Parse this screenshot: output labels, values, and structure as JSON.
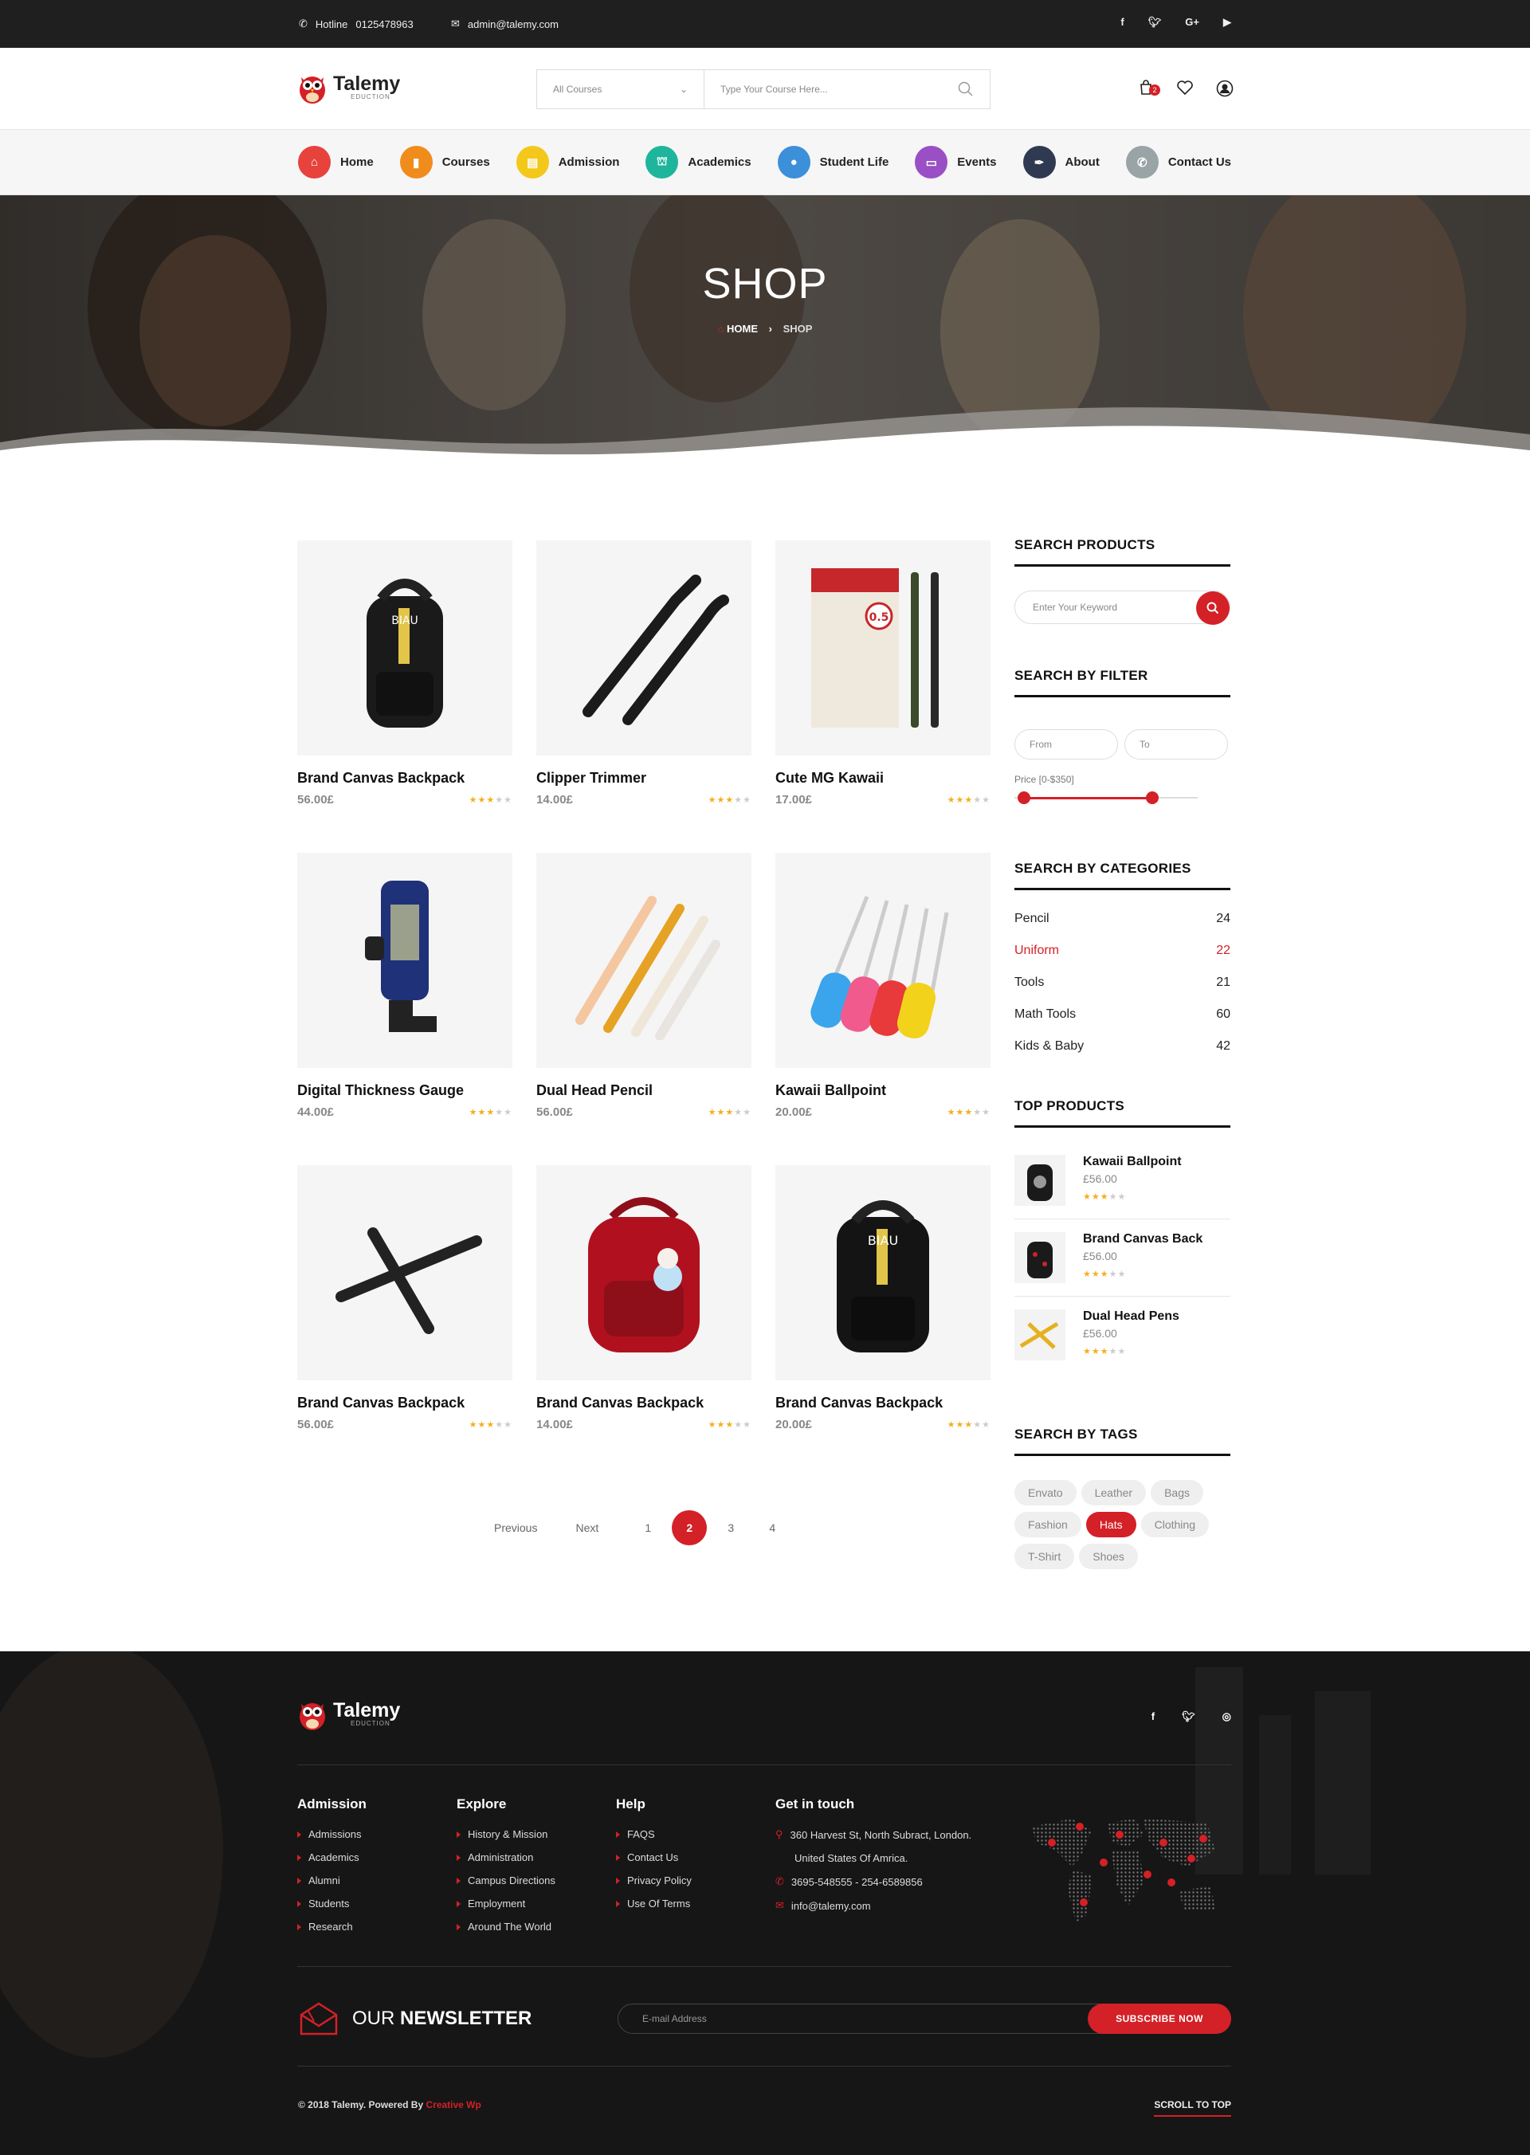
{
  "topbar": {
    "hotline_label": "Hotline",
    "hotline_number": "0125478963",
    "email": "admin@talemy.com",
    "social": [
      "f",
      "t",
      "G+",
      "yt"
    ]
  },
  "brand": {
    "name": "Talemy",
    "tagline": "EDUCTION"
  },
  "header": {
    "category_select": "All Courses",
    "search_placeholder": "Type Your Course Here...",
    "cart_count": "2"
  },
  "nav": {
    "items": [
      {
        "label": "Home",
        "color": "#e8423c"
      },
      {
        "label": "Courses",
        "color": "#f08c1b"
      },
      {
        "label": "Admission",
        "color": "#f3c81a"
      },
      {
        "label": "Academics",
        "color": "#1eb59c"
      },
      {
        "label": "Student Life",
        "color": "#3c8fd9"
      },
      {
        "label": "Events",
        "color": "#9a4fc5"
      },
      {
        "label": "About",
        "color": "#2f3a52"
      },
      {
        "label": "Contact Us",
        "color": "#9aa3a6"
      }
    ]
  },
  "hero": {
    "title": "SHOP",
    "crumb_home": "HOME",
    "crumb_current": "SHOP"
  },
  "products": [
    {
      "name": "Brand Canvas Backpack",
      "price": "56.00£",
      "rating": 3,
      "icon": "black-backpack"
    },
    {
      "name": "Clipper Trimmer",
      "price": "14.00£",
      "rating": 3,
      "icon": "tweezers"
    },
    {
      "name": "Cute MG Kawaii",
      "price": "17.00£",
      "rating": 3,
      "icon": "pen-box"
    },
    {
      "name": "Digital Thickness Gauge",
      "price": "44.00£",
      "rating": 3,
      "icon": "gauge"
    },
    {
      "name": "Dual Head Pencil",
      "price": "56.00£",
      "rating": 3,
      "icon": "pencils"
    },
    {
      "name": "Kawaii Ballpoint",
      "price": "20.00£",
      "rating": 3,
      "icon": "screwdrivers"
    },
    {
      "name": "Brand Canvas Backpack",
      "price": "56.00£",
      "rating": 3,
      "icon": "pencil-holders"
    },
    {
      "name": "Brand Canvas Backpack",
      "price": "14.00£",
      "rating": 3,
      "icon": "red-backpack"
    },
    {
      "name": "Brand Canvas Backpack",
      "price": "20.00£",
      "rating": 3,
      "icon": "black-backpack"
    }
  ],
  "pagination": {
    "previous": "Previous",
    "next": "Next",
    "pages": [
      "1",
      "2",
      "3",
      "4"
    ],
    "current": "2"
  },
  "sidebar": {
    "search_title": "SEARCH PRODUCTS",
    "search_placeholder": "Enter Your Keyword",
    "filter_title": "SEARCH BY FILTER",
    "from_placeholder": "From",
    "to_placeholder": "To",
    "price_label": "Price [0-$350]",
    "price_range_fraction": [
      0.05,
      0.75
    ],
    "categories_title": "SEARCH BY CATEGORIES",
    "categories": [
      {
        "name": "Pencil",
        "count": "24"
      },
      {
        "name": "Uniform",
        "count": "22"
      },
      {
        "name": "Tools",
        "count": "21"
      },
      {
        "name": "Math Tools",
        "count": "60"
      },
      {
        "name": "Kids & Baby",
        "count": "42"
      }
    ],
    "active_category": "Uniform",
    "top_title": "TOP PRODUCTS",
    "top_products": [
      {
        "name": "Kawaii Ballpoint",
        "price": "£56.00",
        "rating": 3
      },
      {
        "name": "Brand Canvas Back",
        "price": "£56.00",
        "rating": 3
      },
      {
        "name": "Dual Head Pens",
        "price": "£56.00",
        "rating": 3
      }
    ],
    "tags_title": "SEARCH BY TAGS",
    "tags": [
      "Envato",
      "Leather",
      "Bags",
      "Fashion",
      "Hats",
      "Clothing",
      "T-Shirt",
      "Shoes"
    ],
    "active_tag": "Hats"
  },
  "footer": {
    "social": [
      "f",
      "t",
      "ig"
    ],
    "admission": {
      "title": "Admission",
      "links": [
        "Admissions",
        "Academics",
        "Alumni",
        "Students",
        "Research"
      ]
    },
    "explore": {
      "title": "Explore",
      "links": [
        "History & Mission",
        "Administration",
        "Campus Directions",
        "Employment",
        "Around The World"
      ]
    },
    "help": {
      "title": "Help",
      "links": [
        "FAQS",
        "Contact Us",
        "Privacy Policy",
        "Use Of Terms"
      ]
    },
    "contact": {
      "title": "Get in touch",
      "address1": "360 Harvest St, North Subract, London.",
      "address2": "United States Of Amrica.",
      "phone": "3695-548555   -   254-6589856",
      "email": "info@talemy.com"
    },
    "newsletter": {
      "title_light": "OUR",
      "title_bold": "NEWSLETTER",
      "placeholder": "E-mail Address",
      "button": "SUBSCRIBE NOW"
    },
    "copyright": "© 2018 Talemy.  Powered By",
    "powered_by": "Creative Wp",
    "scroll_top": "SCROLL TO TOP"
  },
  "colors": {
    "accent": "#d42027",
    "star": "#f2b01e"
  }
}
